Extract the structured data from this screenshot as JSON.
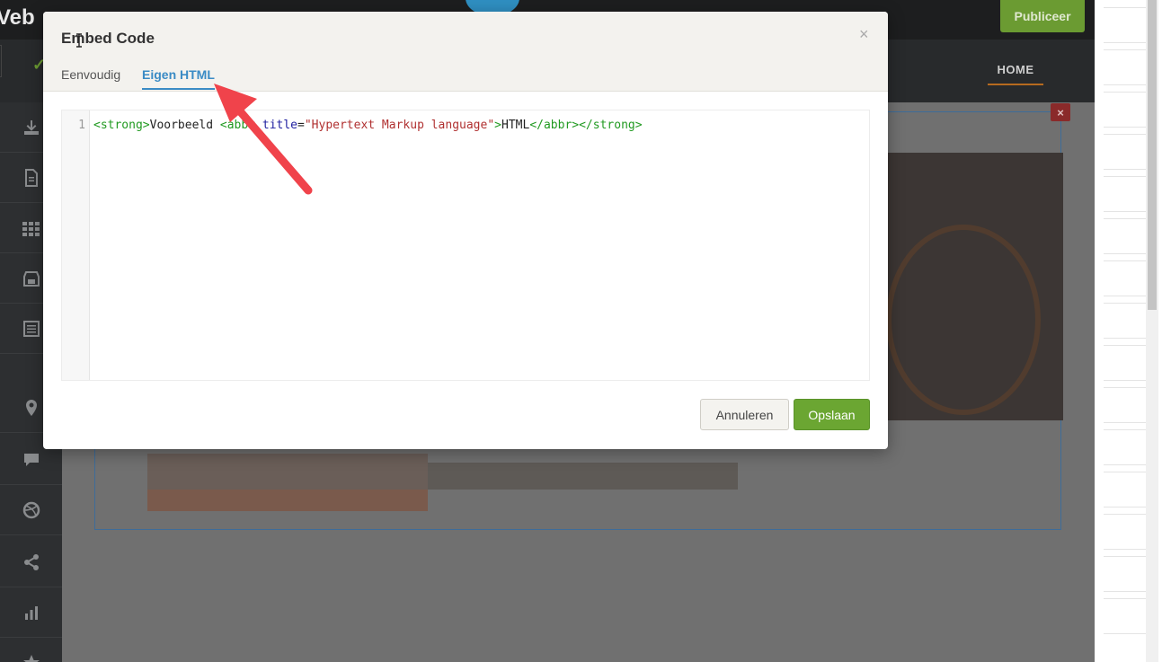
{
  "app": {
    "logo_text": "Veb",
    "publish_label": "Publiceer",
    "nav_home": "HOME",
    "sidebar_icons": [
      "download-icon",
      "page-icon",
      "grid-icon",
      "store-icon",
      "blog-icon",
      "location-icon",
      "comment-icon",
      "dribbble-icon",
      "share-icon",
      "chart-icon",
      "star-icon"
    ],
    "section_delete": "×"
  },
  "modal": {
    "title": "Embed Code",
    "close": "×",
    "tabs": [
      {
        "label": "Eenvoudig",
        "active": false
      },
      {
        "label": "Eigen HTML",
        "active": true
      }
    ],
    "editor": {
      "line_number": "1",
      "tokens": [
        {
          "text": "<strong>",
          "kind": "tag"
        },
        {
          "text": "Voorbeeld ",
          "kind": "txt"
        },
        {
          "text": "<abbr",
          "kind": "tag"
        },
        {
          "text": " ",
          "kind": "txt"
        },
        {
          "text": "title",
          "kind": "attr"
        },
        {
          "text": "=",
          "kind": "txt"
        },
        {
          "text": "\"Hypertext Markup language\"",
          "kind": "str"
        },
        {
          "text": ">",
          "kind": "tag"
        },
        {
          "text": "HTML",
          "kind": "txt"
        },
        {
          "text": "</abbr>",
          "kind": "tag"
        },
        {
          "text": "</strong>",
          "kind": "tag"
        }
      ]
    },
    "cancel_label": "Annuleren",
    "save_label": "Opslaan"
  },
  "colors": {
    "accent_blue": "#3a8bc5",
    "save_green": "#6ba632",
    "annotation_red": "#f0434b"
  }
}
